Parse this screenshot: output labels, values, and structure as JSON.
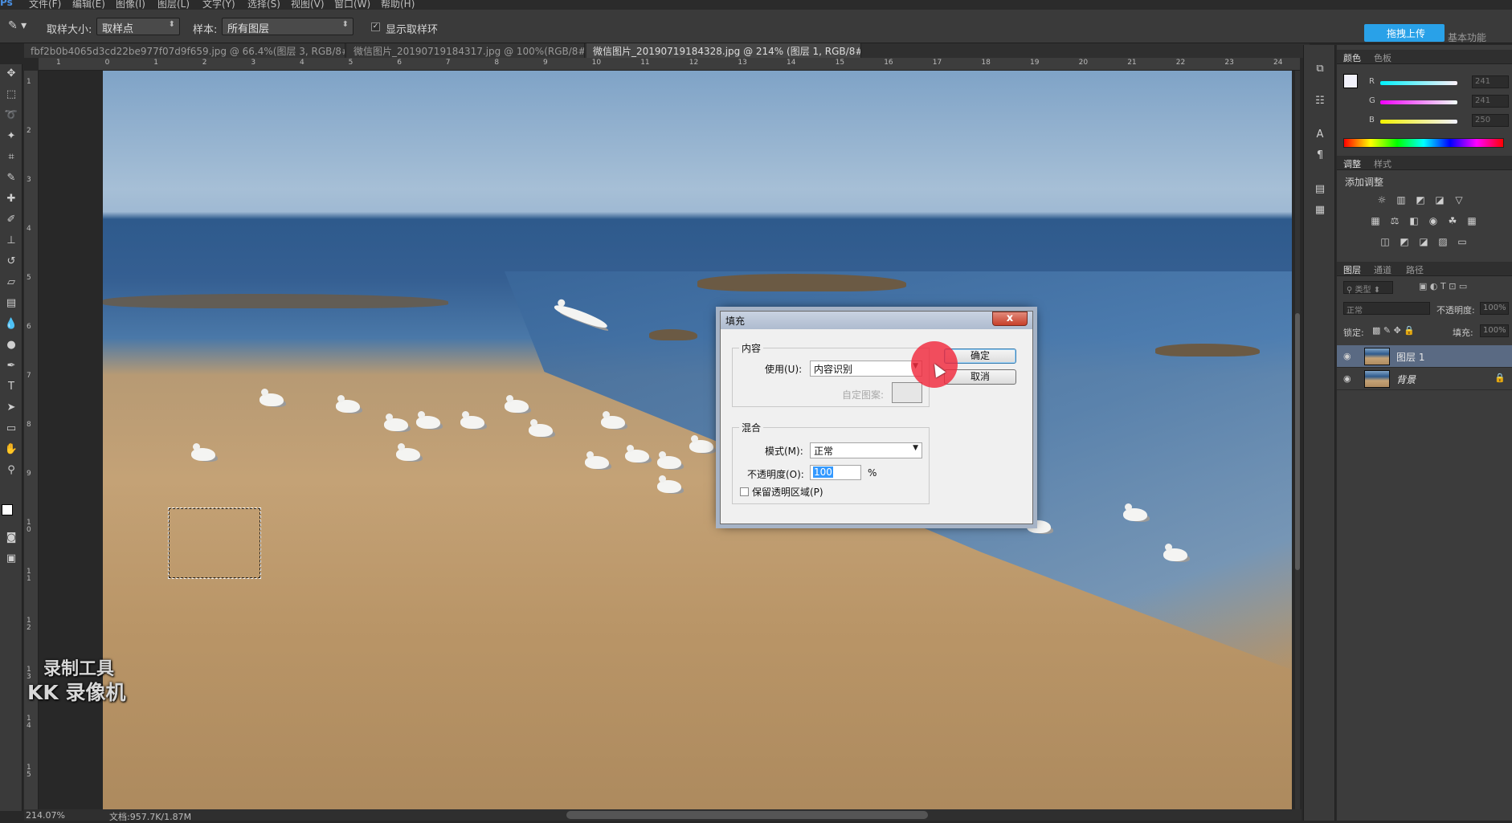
{
  "menu": [
    "文件(F)",
    "编辑(E)",
    "图像(I)",
    "图层(L)",
    "文字(Y)",
    "选择(S)",
    "视图(V)",
    "窗口(W)",
    "帮助(H)"
  ],
  "options": {
    "sample_size_label": "取样大小:",
    "sample_size_value": "取样点",
    "sample_label": "样本:",
    "sample_value": "所有图层",
    "show_ring_label": "显示取样环",
    "upload_label": "拖拽上传",
    "workspace_label": "基本功能"
  },
  "tabs": [
    "fbf2b0b4065d3cd22be977f07d9f659.jpg @ 66.4%(图层 3, RGB/8#) *",
    "微信图片_20190719184317.jpg @ 100%(RGB/8#)",
    "微信图片_20190719184328.jpg @ 214% (图层 1, RGB/8#) *"
  ],
  "ruler_top": [
    "1",
    "0",
    "1",
    "2",
    "3",
    "4",
    "5",
    "6",
    "7",
    "8",
    "9",
    "10",
    "11",
    "12",
    "13",
    "14",
    "15",
    "16",
    "17",
    "18",
    "19",
    "20",
    "21",
    "22",
    "23",
    "24"
  ],
  "ruler_left": [
    "1",
    "2",
    "3",
    "4",
    "5",
    "6",
    "7",
    "8",
    "9",
    "1 0",
    "1 1",
    "1 2",
    "1 3",
    "1 4",
    "1 5"
  ],
  "status": {
    "zoom": "214.07%",
    "doc": "文档:957.7K/1.87M"
  },
  "watermark": {
    "line1": "录制工具",
    "line2": "KK 录像机"
  },
  "dialog": {
    "title": "填充",
    "close": "x",
    "content_group": "内容",
    "use_label": "使用(U):",
    "use_value": "内容识别",
    "custom_pattern_label": "自定图案:",
    "ok": "确定",
    "cancel": "取消",
    "blend_group": "混合",
    "mode_label": "模式(M):",
    "mode_value": "正常",
    "opacity_label": "不透明度(O):",
    "opacity_value": "100",
    "percent": "%",
    "preserve_label": "保留透明区域(P)"
  },
  "panels": {
    "color_tabs": [
      "颜色",
      "色板"
    ],
    "rgb_labels": [
      "R",
      "G",
      "B"
    ],
    "rgb_values": [
      "241",
      "241",
      "250"
    ],
    "adjust_tabs": [
      "调整",
      "样式"
    ],
    "add_adjustment": "添加调整",
    "layers_tabs": [
      "图层",
      "通道",
      "路径"
    ],
    "kind_label": "类型",
    "blend_mode": "正常",
    "opacity_label": "不透明度:",
    "opacity_value": "100%",
    "lock_label": "锁定:",
    "fill_label": "填充:",
    "fill_value": "100%",
    "layers": [
      "图层 1",
      "背景"
    ]
  },
  "colors": {
    "accent": "#29a1e8",
    "selected_layer": "#5a6a83",
    "click_highlight": "#f0283c"
  }
}
